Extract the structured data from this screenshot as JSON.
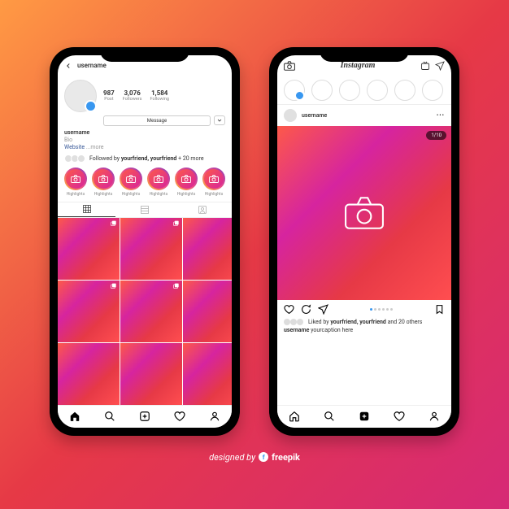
{
  "profile": {
    "username": "username",
    "stats": {
      "posts": {
        "value": "987",
        "label": "Post"
      },
      "followers": {
        "value": "3,076",
        "label": "Followers"
      },
      "following": {
        "value": "1,584",
        "label": "Following"
      }
    },
    "message_label": "Message",
    "bio": {
      "name": "username",
      "line1": "Bio",
      "line2": "Website",
      "more": "...more"
    },
    "mutual": {
      "pre": "Followed by",
      "names": "yourfriend, yourfriend",
      "suffix": "+ 20 more"
    },
    "highlight_label": "Highlights"
  },
  "feed": {
    "app_name": "Instagram",
    "post_user": "username",
    "counter": "1/10",
    "liked": {
      "pre": "Liked by",
      "names": "yourfriend, yourfriend",
      "suffix": "and 20 others"
    },
    "caption_user": "username",
    "caption_text": "yourcaption here"
  },
  "credit": {
    "pre": "designed by",
    "brand": "freepik"
  }
}
